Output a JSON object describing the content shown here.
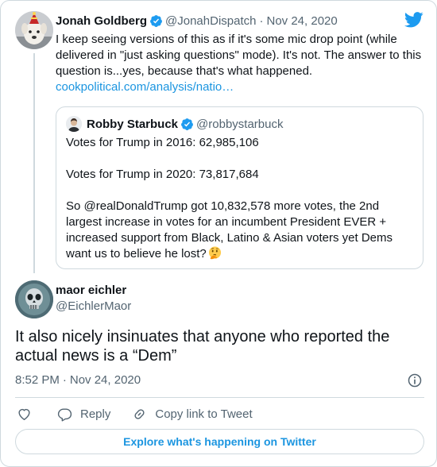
{
  "parent_tweet": {
    "author_name": "Jonah Goldberg",
    "handle": "@JonahDispatch",
    "separator": "·",
    "date": "Nov 24, 2020",
    "text_lines": [
      "I keep seeing versions of this as if it's some mic drop point (while",
      "delivered in \"just asking questions\" mode). It's not. The answer to this",
      "question is...yes, because that's what happened."
    ],
    "link": "cookpolitical.com/analysis/natio…"
  },
  "quoted_tweet": {
    "author_name": "Robby Starbuck",
    "handle": "@robbystarbuck",
    "line1": "Votes for Trump in 2016: 62,985,106",
    "line2": "Votes for Trump in 2020: 73,817,684",
    "para_lines": [
      "So @realDonaldTrump got 10,832,578 more votes, the 2nd",
      "largest increase in votes for an incumbent President EVER +",
      "increased support from Black, Latino & Asian voters yet Dems",
      "want us to believe he lost?"
    ],
    "emoji": "thinking-face-icon"
  },
  "main_tweet": {
    "author_name": "maor eichler",
    "handle": "@EichlerMaor",
    "text_lines": [
      "It also nicely insinuates that anyone who reported the",
      "actual news is a “Dem”"
    ],
    "time": "8:52 PM",
    "separator": "·",
    "date": "Nov 24, 2020"
  },
  "actions": {
    "like_icon": "heart-icon",
    "reply_label": "Reply",
    "copy_link_label": "Copy link to Tweet"
  },
  "explore_label": "Explore what's happening on Twitter",
  "colors": {
    "twitter_blue": "#1d9bf0",
    "link_blue": "#1b95e0",
    "secondary_text": "#536471",
    "border": "#cfd9de"
  }
}
